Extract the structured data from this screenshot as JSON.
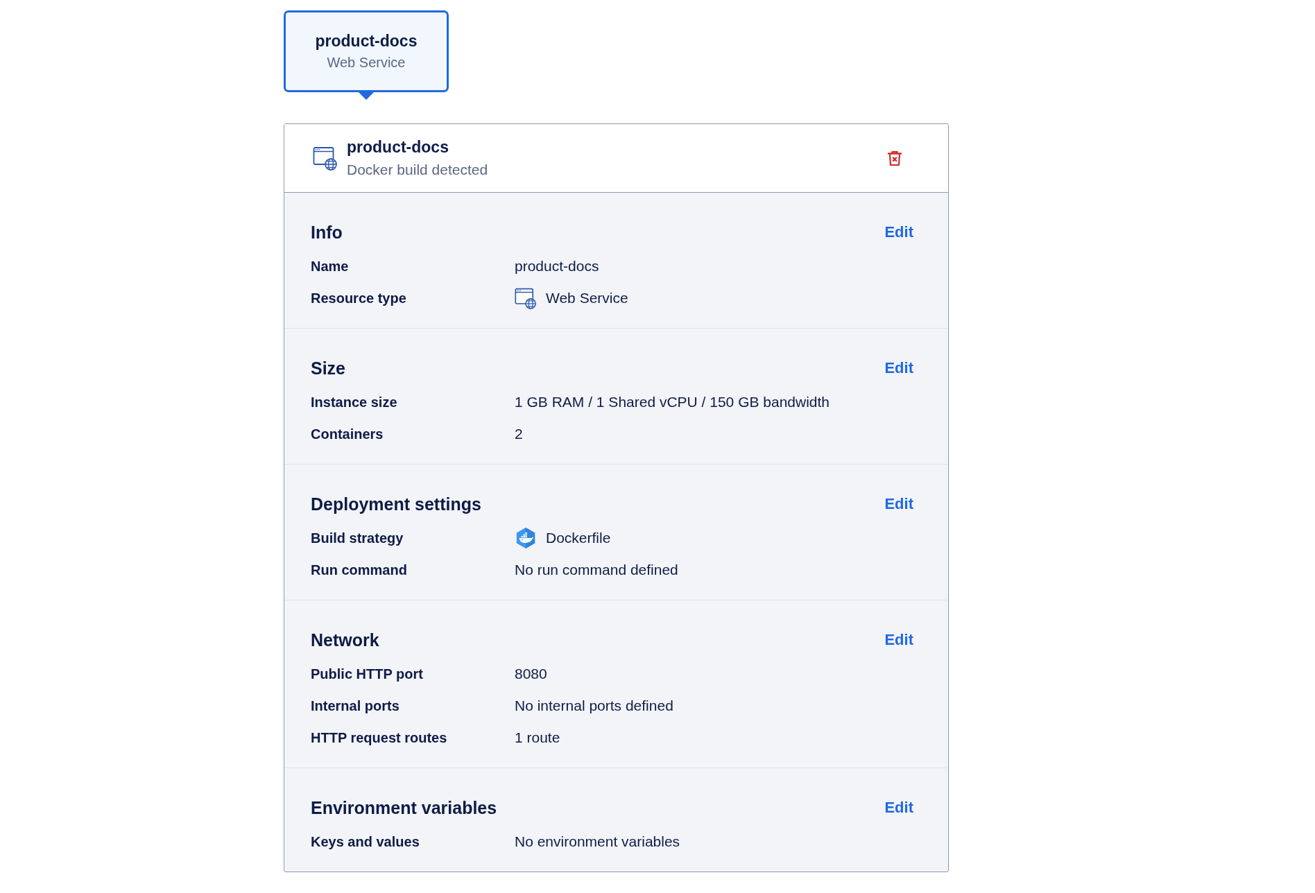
{
  "node_card": {
    "title": "product-docs",
    "subtitle": "Web Service",
    "selected": true
  },
  "component": {
    "kind": "web",
    "title": "product-docs",
    "subtitle": "Docker build detected"
  },
  "sections": [
    {
      "title": "Info",
      "action": "Edit",
      "rows": [
        {
          "label": "Name",
          "value": "product-docs",
          "kind": "plain"
        },
        {
          "label": "Resource type",
          "value": "Web Service",
          "kind": "web"
        }
      ]
    },
    {
      "title": "Size",
      "action": "Edit",
      "rows": [
        {
          "label": "Instance size",
          "value": "1 GB RAM / 1 Shared vCPU / 150 GB bandwidth",
          "kind": "plain"
        },
        {
          "label": "Containers",
          "value": "2",
          "kind": "plain"
        }
      ]
    },
    {
      "title": "Deployment settings",
      "action": "Edit",
      "rows": [
        {
          "label": "Build strategy",
          "value": "Dockerfile",
          "kind": "docker"
        },
        {
          "label": "Run command",
          "value": "No run command defined",
          "kind": "plain"
        }
      ]
    },
    {
      "title": "Network",
      "action": "Edit",
      "rows": [
        {
          "label": "Public HTTP port",
          "value": "8080",
          "kind": "plain"
        },
        {
          "label": "Internal ports",
          "value": "No internal ports defined",
          "kind": "plain"
        },
        {
          "label": "HTTP request routes",
          "value": "1 route",
          "kind": "plain"
        }
      ]
    },
    {
      "title": "Environment variables",
      "action": "Edit",
      "rows": [
        {
          "label": "Keys and values",
          "value": "No environment variables",
          "kind": "plain"
        }
      ]
    }
  ]
}
